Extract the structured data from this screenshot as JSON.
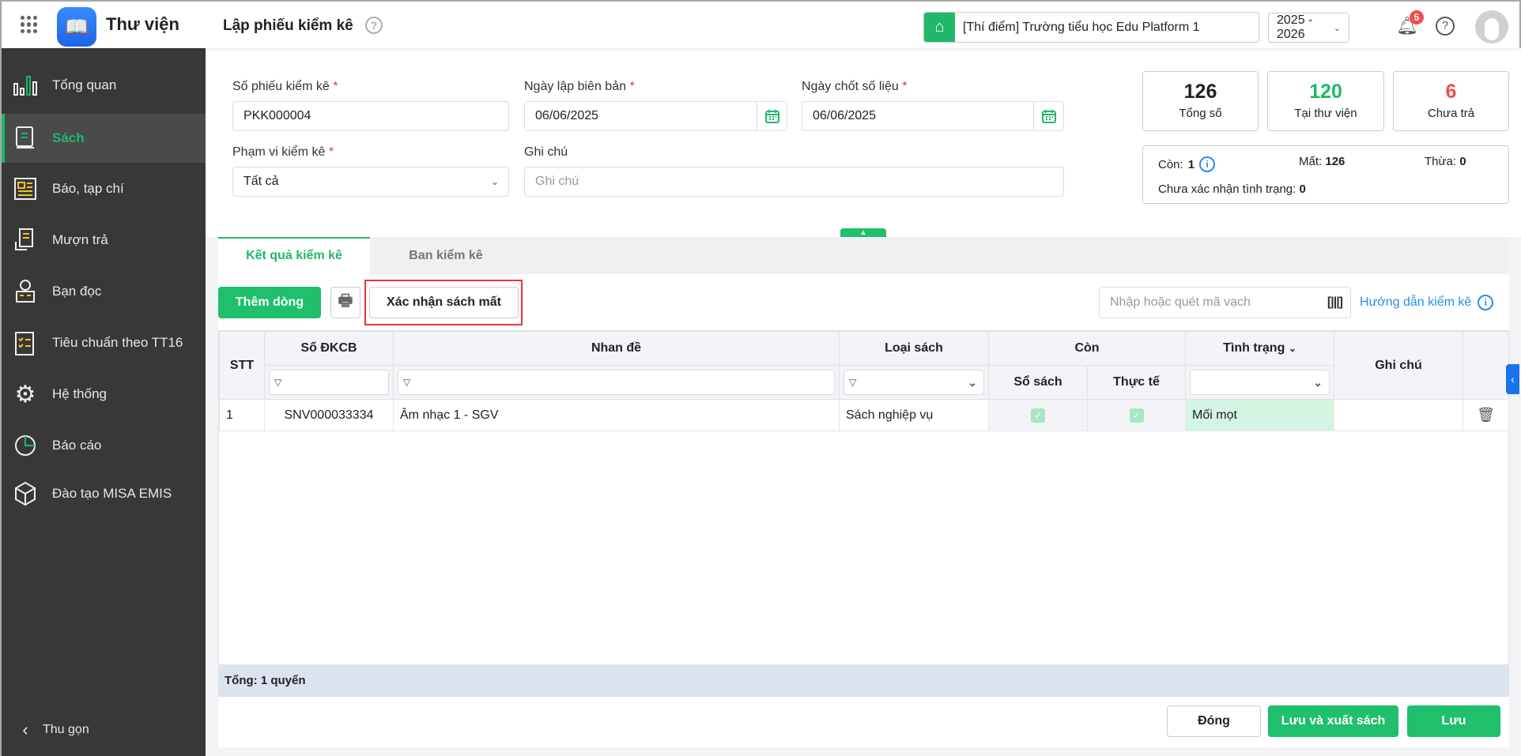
{
  "header": {
    "app_name": "Thư viện",
    "page_title": "Lập phiếu kiểm kê",
    "school": "[Thí điểm] Trường tiểu học Edu Platform 1",
    "school_year": "2025 - 2026",
    "notification_count": "5"
  },
  "sidebar": {
    "items": [
      {
        "label": "Tổng quan"
      },
      {
        "label": "Sách"
      },
      {
        "label": "Báo, tạp chí"
      },
      {
        "label": "Mượn trả"
      },
      {
        "label": "Bạn đọc"
      },
      {
        "label": "Tiêu chuẩn theo TT16"
      },
      {
        "label": "Hệ thống"
      },
      {
        "label": "Báo cáo"
      },
      {
        "label": "Đào tạo MISA EMIS"
      }
    ],
    "collapse_label": "Thu gọn"
  },
  "form": {
    "so_phieu_label": "Số phiếu kiểm kê",
    "so_phieu_value": "PKK000004",
    "ngay_lap_label": "Ngày lập biên bản",
    "ngay_lap_value": "06/06/2025",
    "ngay_chot_label": "Ngày chốt số liệu",
    "ngay_chot_value": "06/06/2025",
    "pham_vi_label": "Phạm vi kiểm kê",
    "pham_vi_value": "Tất cả",
    "ghi_chu_label": "Ghi chú",
    "ghi_chu_placeholder": "Ghi chú",
    "required_mark": "*"
  },
  "stats": {
    "total": {
      "value": "126",
      "label": "Tổng số",
      "color": "#111111"
    },
    "in_library": {
      "value": "120",
      "label": "Tại thư viện",
      "color": "#1fb86a"
    },
    "not_returned": {
      "value": "6",
      "label": "Chưa trả",
      "color": "#f04e4e"
    }
  },
  "summary": {
    "con_label": "Còn:",
    "con_value": "1",
    "mat_label": "Mất:",
    "mat_value": "126",
    "thua_label": "Thừa:",
    "thua_value": "0",
    "chua_xn_label": "Chưa xác nhận tình trạng:",
    "chua_xn_value": "0"
  },
  "tabs": [
    {
      "label": "Kết quả kiểm kê",
      "active": true
    },
    {
      "label": "Ban kiểm kê",
      "active": false
    }
  ],
  "toolbar": {
    "add_row": "Thêm dòng",
    "confirm_lost": "Xác nhận sách mất",
    "barcode_placeholder": "Nhập hoặc quét mã vạch",
    "guide": "Hướng dẫn kiểm kê"
  },
  "table": {
    "headers": {
      "stt": "STT",
      "so_dkcb": "Số ĐKCB",
      "nhan_de": "Nhan đề",
      "loai_sach": "Loại sách",
      "con": "Còn",
      "so_sach": "Sổ sách",
      "thuc_te": "Thực tế",
      "tinh_trang": "Tình trạng",
      "ghi_chu": "Ghi chú"
    },
    "rows": [
      {
        "stt": "1",
        "so_dkcb": "SNV000033334",
        "nhan_de": "Âm nhạc 1 - SGV",
        "loai_sach": "Sách nghiệp vụ",
        "so_sach": true,
        "thuc_te": true,
        "tinh_trang": "Mối mọt",
        "ghi_chu": ""
      }
    ],
    "footer": "Tổng: 1 quyển"
  },
  "actions": {
    "close": "Đóng",
    "save_export": "Lưu và xuất sách",
    "save": "Lưu"
  }
}
